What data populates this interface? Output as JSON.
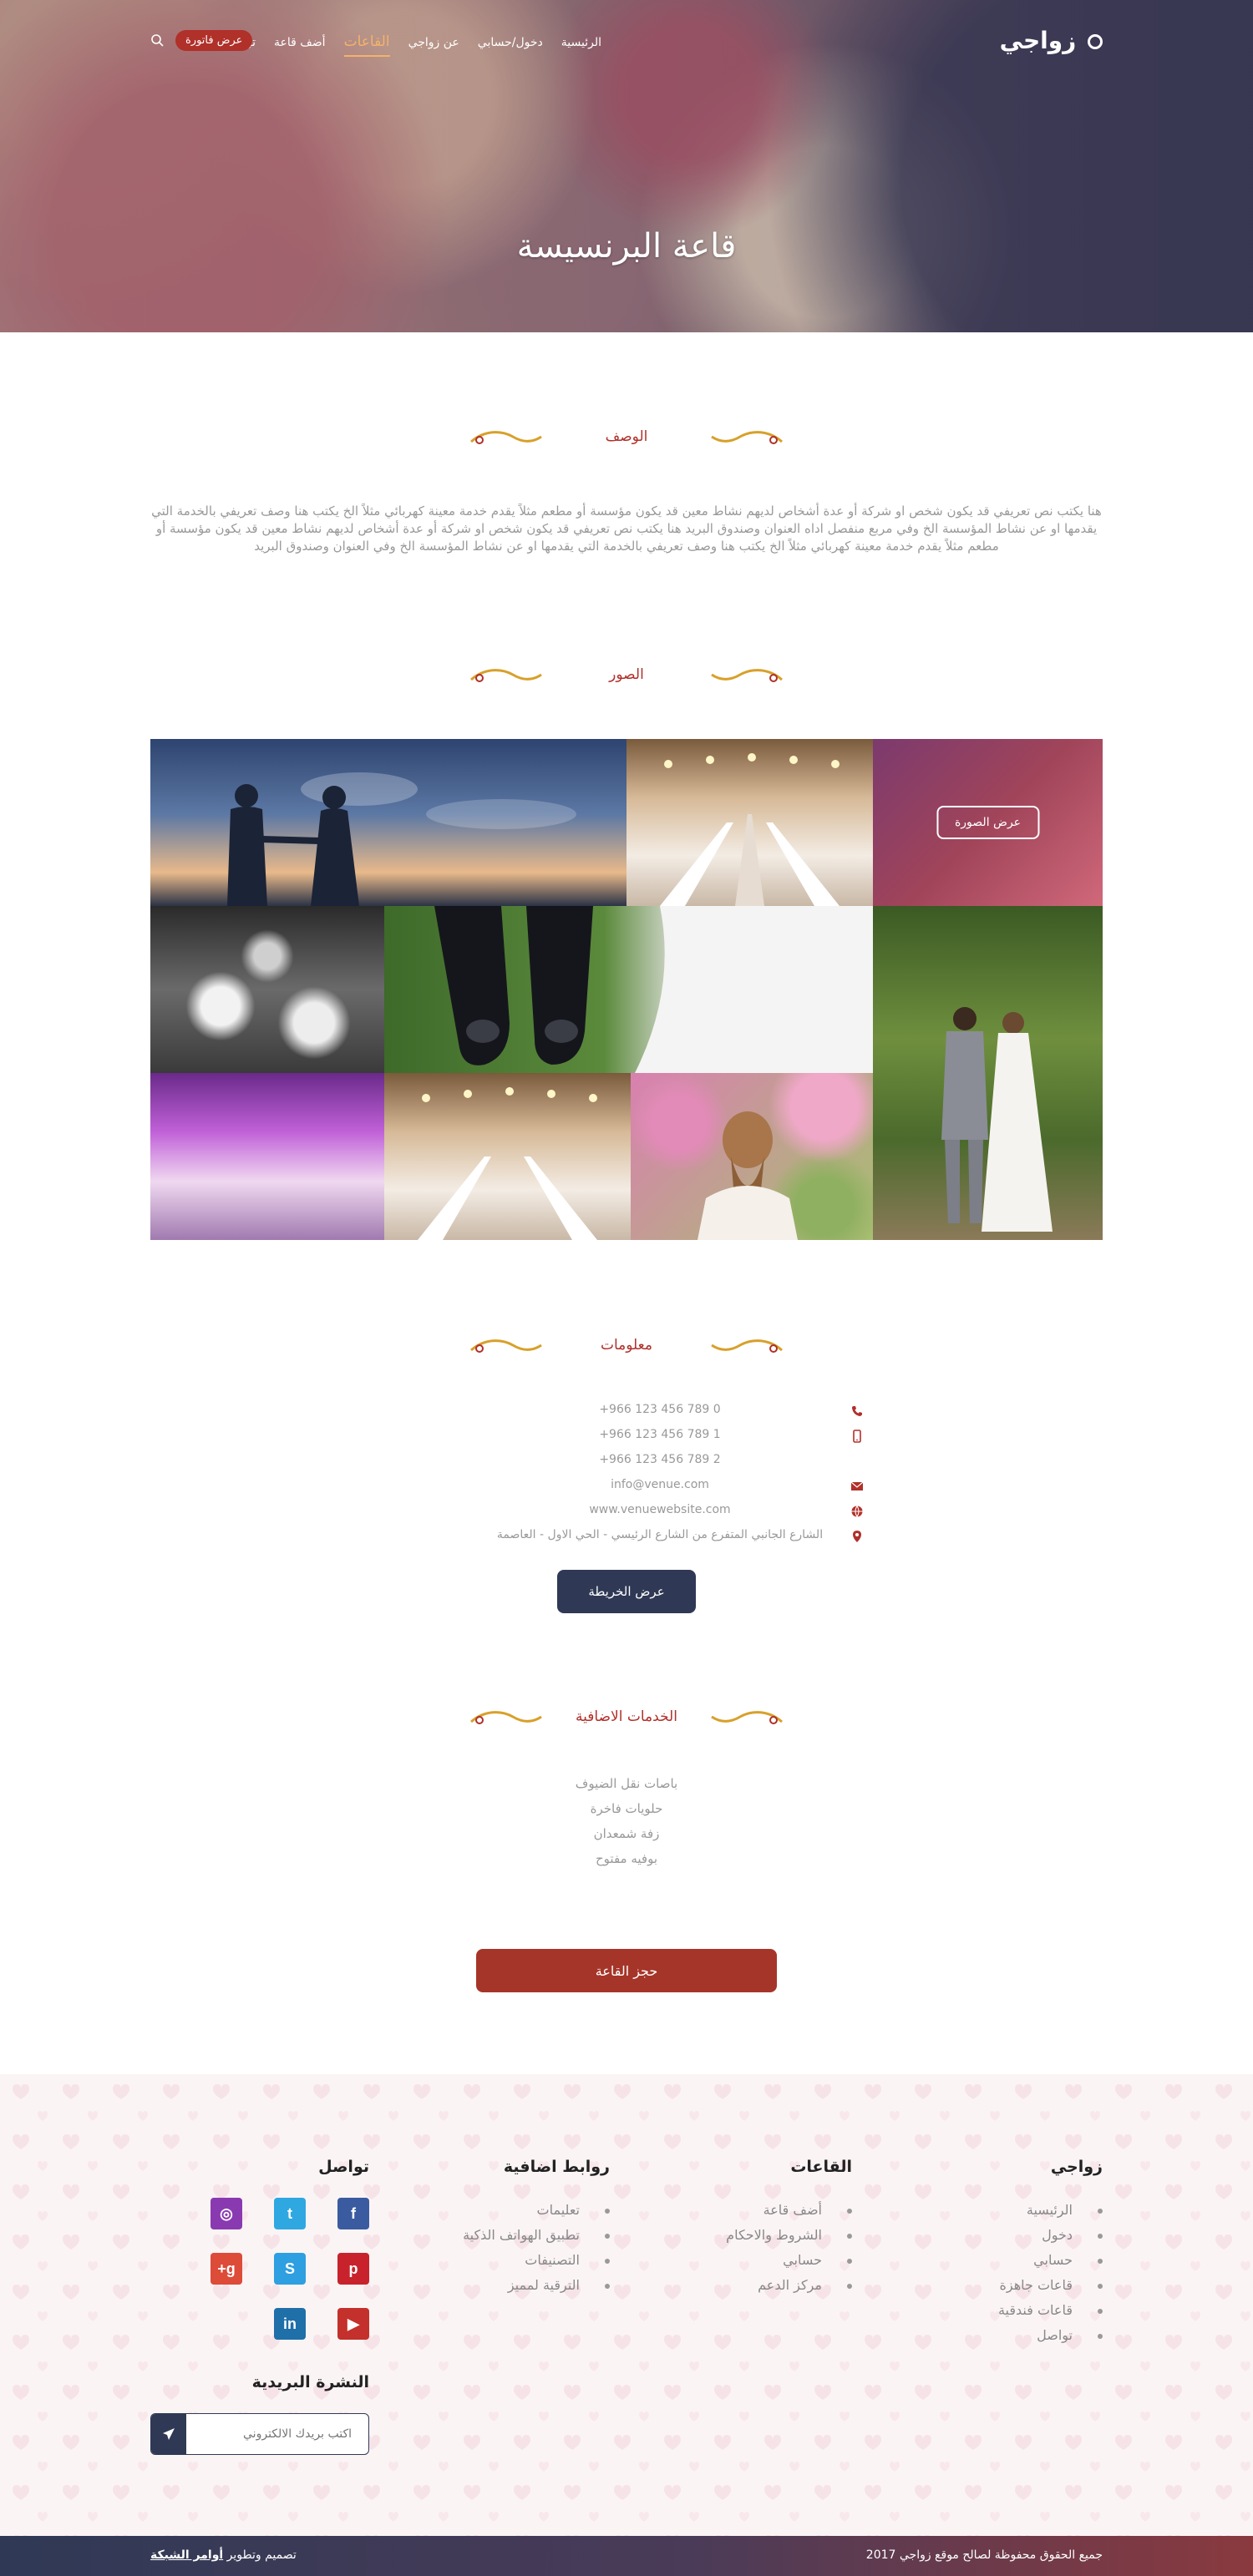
{
  "brand": {
    "logo_text": "زواجي"
  },
  "nav": {
    "items": [
      "الرئيسية",
      "دخول/حسابي",
      "عن زواجي",
      "القاعات",
      "أضف قاعة",
      "تواصل"
    ],
    "active_index": 3,
    "cta_label": "عرض فاتورة",
    "accent_color": "#f4b26b",
    "cta_color": "#b0302a"
  },
  "hero": {
    "title": "قاعة البرنسيسة"
  },
  "description": {
    "heading": "الوصف",
    "text": "هنا يكتب نص تعريفي قد يكون شخص او شركة أو عدة أشخاص لديهم نشاط معين قد يكون مؤسسة أو مطعم مثلاً يقدم خدمة معينة كهربائي مثلاً الخ يكتب هنا وصف تعريفي بالخدمة التي يقدمها او عن نشاط المؤسسة الخ وفي مربع منفصل اداه العنوان وصندوق البريد هنا يكتب نص تعريفي قد يكون شخص او شركة أو عدة أشخاص لديهم نشاط معين قد يكون مؤسسة أو مطعم مثلاً يقدم خدمة معينة كهربائي مثلاً الخ يكتب هنا وصف تعريفي بالخدمة التي يقدمها او عن نشاط المؤسسة الخ وفي العنوان وصندوق البريد"
  },
  "gallery": {
    "heading": "الصور",
    "view_label": "عرض الصورة"
  },
  "info": {
    "heading": "معلومات",
    "phone": "+966 123 456 789 0",
    "mobile": "+966 123 456 789 1",
    "fax": "+966 123 456 789 2",
    "email": "info@venue.com",
    "website": "www.venuewebsite.com",
    "address": "الشارع الجانبي المتفرع من الشارع الرئيسي - الحي الاول - العاصمة",
    "map_button": "عرض الخريطة"
  },
  "services": {
    "heading": "الخدمات الاضافية",
    "items": [
      "باصات نقل الضيوف",
      "حلويات فاخرة",
      "زفة شمعدان",
      "بوفيه مفتوح"
    ]
  },
  "booking": {
    "button": "حجز القاعة"
  },
  "footer": {
    "col1": {
      "title": "زواجي",
      "items": [
        "الرئيسية",
        "دخول",
        "حسابي",
        "قاعات جاهزة",
        "قاعات فندقية",
        "تواصل"
      ]
    },
    "col2": {
      "title": "القاعات",
      "items": [
        "أضف قاعة",
        "الشروط والاحكام",
        "حسابي",
        "مركز الدعم"
      ]
    },
    "col3": {
      "title": "روابط اضافية",
      "items": [
        "تعليمات",
        "تطبيق الهواتف الذكية",
        "التصنيفات",
        "الترقية لمميز"
      ]
    },
    "col4": {
      "title": "تواصل"
    },
    "newsletter": {
      "title": "النشرة البريدية",
      "placeholder": "اكتب بريدك الالكتروني"
    },
    "copyright": "جميع الحقوق محفوظة لصالح موقع زواجي 2017",
    "credit_prefix": "تصميم وتطوير",
    "credit_link": "أوامر الشبكة"
  },
  "socials": [
    {
      "name": "facebook-icon",
      "glyph": "f",
      "color": "#3b5ba0"
    },
    {
      "name": "twitter-icon",
      "glyph": "t",
      "color": "#2fa8e1"
    },
    {
      "name": "instagram-icon",
      "glyph": "◎",
      "color": "#8a3ab0"
    },
    {
      "name": "pinterest-icon",
      "glyph": "p",
      "color": "#c8232c"
    },
    {
      "name": "skype-icon",
      "glyph": "S",
      "color": "#2e9fe0"
    },
    {
      "name": "google-plus-icon",
      "glyph": "g+",
      "color": "#dd4b39"
    },
    {
      "name": "youtube-icon",
      "glyph": "▶",
      "color": "#c4302b"
    },
    {
      "name": "linkedin-icon",
      "glyph": "in",
      "color": "#1f6fa8"
    }
  ]
}
